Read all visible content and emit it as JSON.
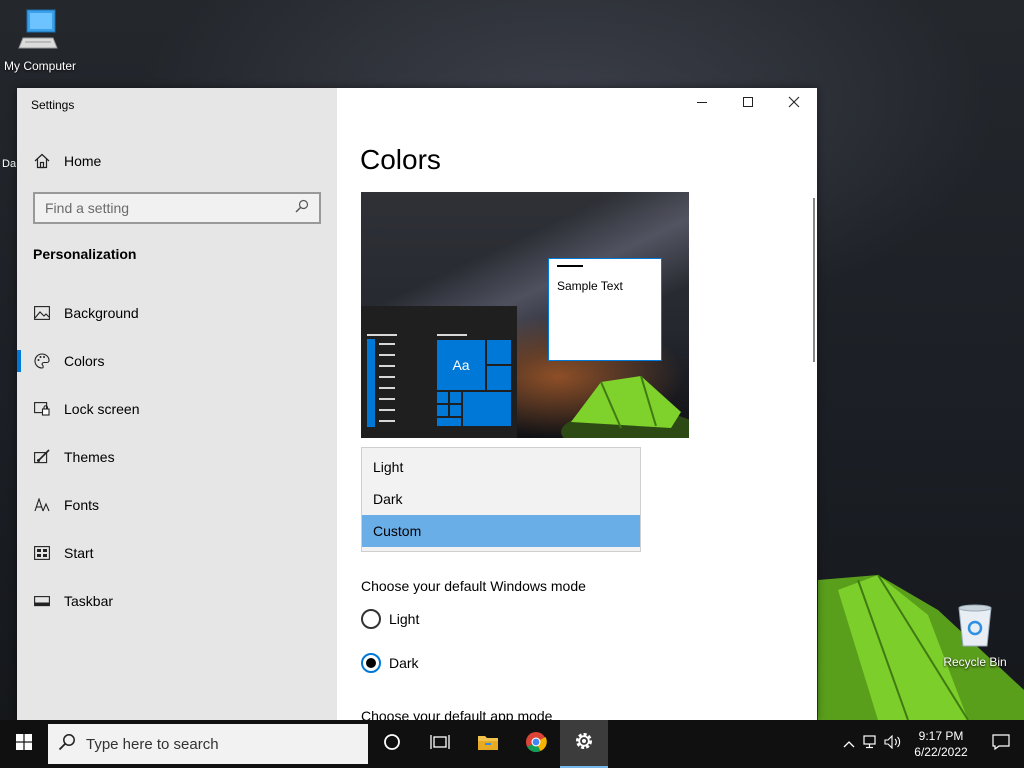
{
  "desktop": {
    "icons": [
      {
        "label": "My Computer",
        "icon": "computer-icon"
      },
      {
        "label": "Recycle Bin",
        "icon": "recycle-bin-icon"
      }
    ],
    "peek_label": "Da"
  },
  "settings": {
    "window_title": "Settings",
    "home_label": "Home",
    "search": {
      "placeholder": "Find a setting",
      "value": ""
    },
    "section": "Personalization",
    "nav": [
      {
        "label": "Background",
        "icon": "picture-icon"
      },
      {
        "label": "Colors",
        "icon": "palette-icon",
        "selected": true
      },
      {
        "label": "Lock screen",
        "icon": "lock-screen-icon"
      },
      {
        "label": "Themes",
        "icon": "brush-icon"
      },
      {
        "label": "Fonts",
        "icon": "font-icon"
      },
      {
        "label": "Start",
        "icon": "start-icon"
      },
      {
        "label": "Taskbar",
        "icon": "taskbar-icon"
      }
    ],
    "page_title": "Colors",
    "preview": {
      "tile_text": "Aa",
      "sample_text": "Sample Text"
    },
    "color_dropdown": {
      "options": [
        "Light",
        "Dark",
        "Custom"
      ],
      "selected": "Custom"
    },
    "windows_mode": {
      "label": "Choose your default Windows mode",
      "options": [
        "Light",
        "Dark"
      ],
      "selected": "Dark"
    },
    "app_mode_label": "Choose your default app mode"
  },
  "taskbar": {
    "search_placeholder": "Type here to search",
    "apps": [
      "cortana-icon",
      "task-view-icon",
      "file-explorer-icon",
      "chrome-icon",
      "settings-gear-icon"
    ],
    "active_app": "settings-gear-icon",
    "clock": {
      "time": "9:17 PM",
      "date": "6/22/2022"
    }
  },
  "colors": {
    "accent": "#0078d7",
    "sidebar_bg": "#e6e6e6",
    "dropdown_selected": "#6aaee8",
    "taskbar_bg": "#101010"
  }
}
